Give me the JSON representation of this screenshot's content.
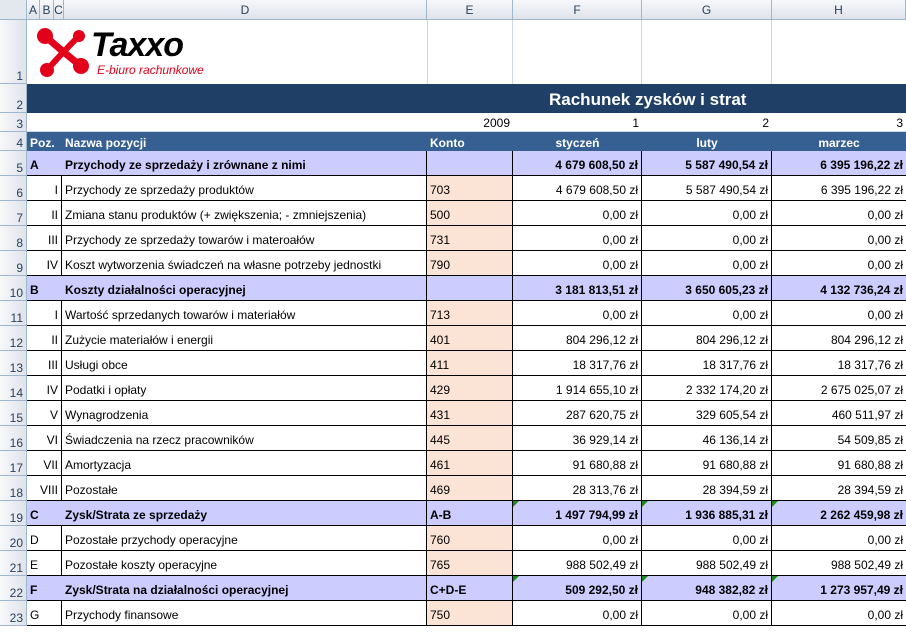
{
  "columns": [
    "A",
    "B",
    "C",
    "D",
    "E",
    "F",
    "G",
    "H"
  ],
  "logo": {
    "name": "Taxxo",
    "tagline": "E-biuro rachunkowe",
    "colors": {
      "mark": "#e2001a",
      "text": "#000000"
    }
  },
  "title": "Rachunek zysków i strat",
  "row3": {
    "year": "2009",
    "m1": "1",
    "m2": "2",
    "m3": "3"
  },
  "header": {
    "poz": "Poz.",
    "nazwa": "Nazwa pozycji",
    "konto": "Konto",
    "styczen": "styczeń",
    "luty": "luty",
    "marzec": "marzec"
  },
  "rows": [
    {
      "num": "5",
      "poz": "A",
      "name": "Przychody ze sprzedaży i zrównane z nimi",
      "konto": "",
      "v1": "4 679 608,50 zł",
      "v2": "5 587 490,54 zł",
      "v3": "6 395 196,22 zł",
      "band": true
    },
    {
      "num": "6",
      "poz": "I",
      "name": "Przychody ze sprzedaży produktów",
      "konto": "703",
      "v1": "4 679 608,50 zł",
      "v2": "5 587 490,54 zł",
      "v3": "6 395 196,22 zł"
    },
    {
      "num": "7",
      "poz": "II",
      "name": "Zmiana stanu produktów (+ zwiększenia; - zmniejszenia)",
      "konto": "500",
      "v1": "0,00 zł",
      "v2": "0,00 zł",
      "v3": "0,00 zł"
    },
    {
      "num": "8",
      "poz": "III",
      "name": "Przychody ze sprzedaży towarów i materoałów",
      "konto": "731",
      "v1": "0,00 zł",
      "v2": "0,00 zł",
      "v3": "0,00 zł"
    },
    {
      "num": "9",
      "poz": "IV",
      "name": "Koszt wytworzenia świadczeń na własne potrzeby jednostki",
      "konto": "790",
      "v1": "0,00 zł",
      "v2": "0,00 zł",
      "v3": "0,00 zł"
    },
    {
      "num": "10",
      "poz": "B",
      "name": "Koszty działalności operacyjnej",
      "konto": "",
      "v1": "3 181 813,51 zł",
      "v2": "3 650 605,23 zł",
      "v3": "4 132 736,24 zł",
      "band": true
    },
    {
      "num": "11",
      "poz": "I",
      "name": "Wartość sprzedanych towarów i materiałów",
      "konto": "713",
      "v1": "0,00 zł",
      "v2": "0,00 zł",
      "v3": "0,00 zł"
    },
    {
      "num": "12",
      "poz": "II",
      "name": "Zużycie materiałów i energii",
      "konto": "401",
      "v1": "804 296,12 zł",
      "v2": "804 296,12 zł",
      "v3": "804 296,12 zł"
    },
    {
      "num": "13",
      "poz": "III",
      "name": "Usługi obce",
      "konto": "411",
      "v1": "18 317,76 zł",
      "v2": "18 317,76 zł",
      "v3": "18 317,76 zł"
    },
    {
      "num": "14",
      "poz": "IV",
      "name": "Podatki i opłaty",
      "konto": "429",
      "v1": "1 914 655,10 zł",
      "v2": "2 332 174,20 zł",
      "v3": "2 675 025,07 zł"
    },
    {
      "num": "15",
      "poz": "V",
      "name": "Wynagrodzenia",
      "konto": "431",
      "v1": "287 620,75 zł",
      "v2": "329 605,54 zł",
      "v3": "460 511,97 zł"
    },
    {
      "num": "16",
      "poz": "VI",
      "name": "Świadczenia na rzecz pracowników",
      "konto": "445",
      "v1": "36 929,14 zł",
      "v2": "46 136,14 zł",
      "v3": "54 509,85 zł"
    },
    {
      "num": "17",
      "poz": "VII",
      "name": "Amortyzacja",
      "konto": "461",
      "v1": "91 680,88 zł",
      "v2": "91 680,88 zł",
      "v3": "91 680,88 zł"
    },
    {
      "num": "18",
      "poz": "VIII",
      "name": "Pozostałe",
      "konto": "469",
      "v1": "28 313,76 zł",
      "v2": "28 394,59 zł",
      "v3": "28 394,59 zł"
    },
    {
      "num": "19",
      "poz": "C",
      "name": "Zysk/Strata ze sprzedaży",
      "konto": "A-B",
      "v1": "1 497 794,99 zł",
      "v2": "1 936 885,31 zł",
      "v3": "2 262 459,98 zł",
      "band": true
    },
    {
      "num": "20",
      "poz": "D",
      "name": "Pozostałe przychody operacyjne",
      "konto": "760",
      "v1": "0,00 zł",
      "v2": "0,00 zł",
      "v3": "0,00 zł",
      "left": true
    },
    {
      "num": "21",
      "poz": "E",
      "name": "Pozostałe koszty operacyjne",
      "konto": "765",
      "v1": "988 502,49 zł",
      "v2": "988 502,49 zł",
      "v3": "988 502,49 zł",
      "left": true
    },
    {
      "num": "22",
      "poz": "F",
      "name": "Zysk/Strata na działalności operacyjnej",
      "konto": "C+D-E",
      "v1": "509 292,50 zł",
      "v2": "948 382,82 zł",
      "v3": "1 273 957,49 zł",
      "band": true
    },
    {
      "num": "23",
      "poz": "G",
      "name": "Przychody finansowe",
      "konto": "750",
      "v1": "0,00 zł",
      "v2": "0,00 zł",
      "v3": "0,00 zł",
      "left": true
    }
  ]
}
